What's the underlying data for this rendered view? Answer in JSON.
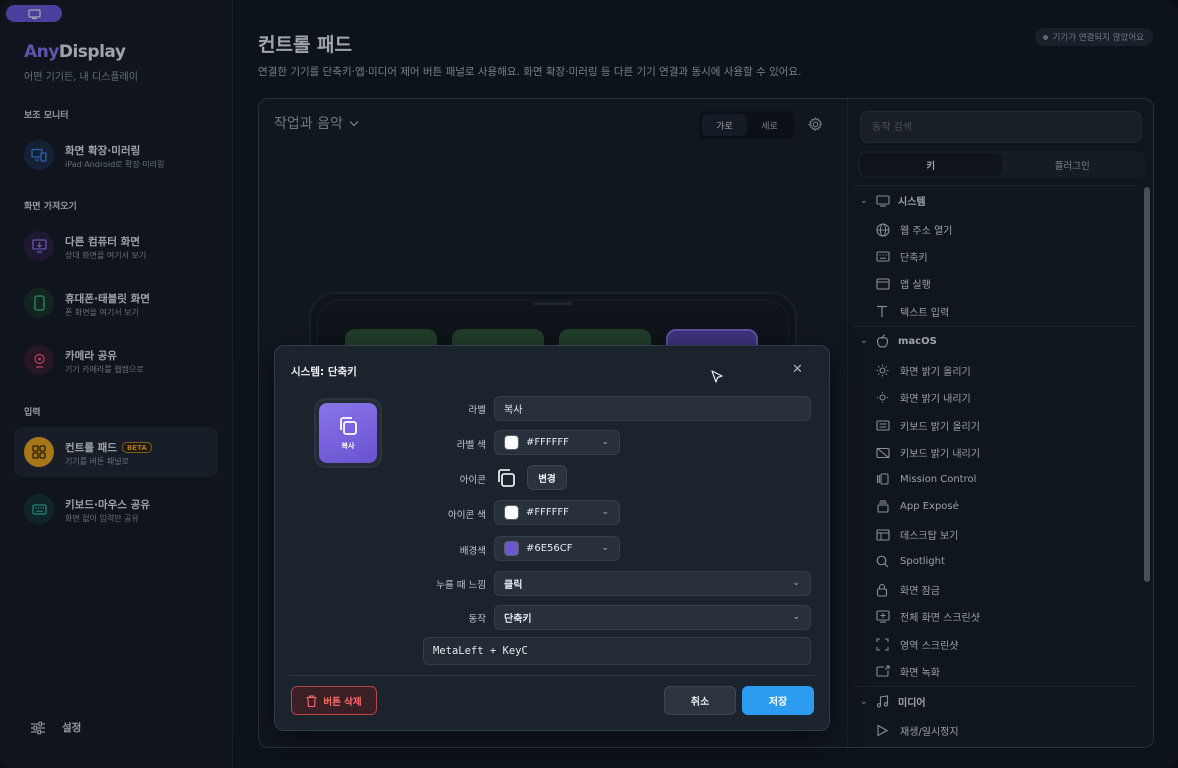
{
  "app": {
    "brand_part1": "Any",
    "brand_part2": "Display",
    "tagline": "어떤 기기든, 내 디스플레이"
  },
  "sidebar": {
    "sections": [
      {
        "title": "보조 모니터"
      },
      {
        "title": "화면 가져오기"
      },
      {
        "title": "입력"
      }
    ],
    "items": [
      {
        "title": "화면 확장·미러링",
        "subtitle": "iPad·Android로 확장·미러링",
        "icon": "monitor-phone-icon",
        "color": "#3f8cff"
      },
      {
        "title": "다른 컴퓨터 화면",
        "subtitle": "상대 화면을 여기서 보기",
        "icon": "monitor-download-icon",
        "color": "#9b7bff"
      },
      {
        "title": "휴대폰·태블릿 화면",
        "subtitle": "폰 화면을 여기서 보기",
        "icon": "phone-icon",
        "color": "#3fcf8e"
      },
      {
        "title": "카메라 공유",
        "subtitle": "기기 카메라를 웹캠으로",
        "icon": "webcam-icon",
        "color": "#ff5c93"
      },
      {
        "title": "컨트롤 패드",
        "subtitle": "기기를 버튼 패널로",
        "badge": "BETA",
        "icon": "grid-icon",
        "color": "#ffb020",
        "active": true
      },
      {
        "title": "키보드·마우스 공유",
        "subtitle": "화면 없이 입력만 공유",
        "icon": "keyboard-icon",
        "color": "#2fc3b5"
      }
    ],
    "settings_label": "설정"
  },
  "header": {
    "title": "컨트롤 패드",
    "description": "연결한 기기를 단축키·앱·미디어 제어 버튼 패널로 사용해요. 화면 확장·미러링 등 다른 기기 연결과 동시에 사용할 수 있어요.",
    "status": "기기가 연결되지 않았어요"
  },
  "workspace": {
    "profile": "작업과 음악",
    "orientation": [
      "가로",
      "세로"
    ],
    "orientation_selected": "가로",
    "key_colors": [
      "#2f5a3a",
      "#2f5a3a",
      "#2f5a3a",
      "#5a49b8"
    ]
  },
  "actions_panel": {
    "search_placeholder": "동작 검색",
    "tabs": [
      "키",
      "플러그인"
    ],
    "tab_selected": "키",
    "groups": [
      {
        "name": "시스템",
        "icon": "monitor-icon",
        "items": [
          {
            "label": "웹 주소 열기",
            "icon": "globe-icon"
          },
          {
            "label": "단축키",
            "icon": "keyboard-icon"
          },
          {
            "label": "앱 실행",
            "icon": "app-window-icon"
          },
          {
            "label": "텍스트 입력",
            "icon": "text-icon"
          }
        ]
      },
      {
        "name": "macOS",
        "icon": "apple-icon",
        "items": [
          {
            "label": "화면 밝기 올리기",
            "icon": "sun-icon"
          },
          {
            "label": "화면 밝기 내리기",
            "icon": "sun-dim-icon"
          },
          {
            "label": "키보드 밝기 올리기",
            "icon": "keyboard-light-icon"
          },
          {
            "label": "키보드 밝기 내리기",
            "icon": "keyboard-off-icon"
          },
          {
            "label": "Mission Control",
            "icon": "mission-control-icon"
          },
          {
            "label": "App Exposé",
            "icon": "app-expose-icon"
          },
          {
            "label": "데스크탑 보기",
            "icon": "desktop-icon"
          },
          {
            "label": "Spotlight",
            "icon": "search-icon"
          },
          {
            "label": "화면 잠금",
            "icon": "lock-icon"
          },
          {
            "label": "전체 화면 스크린샷",
            "icon": "screenshot-icon"
          },
          {
            "label": "영역 스크린샷",
            "icon": "crop-icon"
          },
          {
            "label": "화면 녹화",
            "icon": "record-icon"
          }
        ]
      },
      {
        "name": "미디어",
        "icon": "music-icon",
        "items": [
          {
            "label": "재생/일시정지",
            "icon": "play-icon"
          }
        ]
      }
    ]
  },
  "dialog": {
    "title": "시스템: 단축키",
    "preview_label": "복사",
    "fields": {
      "label_label": "라벨",
      "label_value": "복사",
      "label_color_label": "라벨 색",
      "label_color_value": "#FFFFFF",
      "icon_label": "아이콘",
      "change_button": "변경",
      "icon_color_label": "아이콘 색",
      "icon_color_value": "#FFFFFF",
      "bg_color_label": "배경색",
      "bg_color_value": "#6E56CF",
      "feedback_label": "누를 때 느낌",
      "feedback_value": "클릭",
      "action_label": "동작",
      "action_value": "단축키",
      "shortcut_value": "MetaLeft + KeyC"
    },
    "delete_button": "버튼 삭제",
    "cancel_button": "취소",
    "save_button": "저장"
  }
}
